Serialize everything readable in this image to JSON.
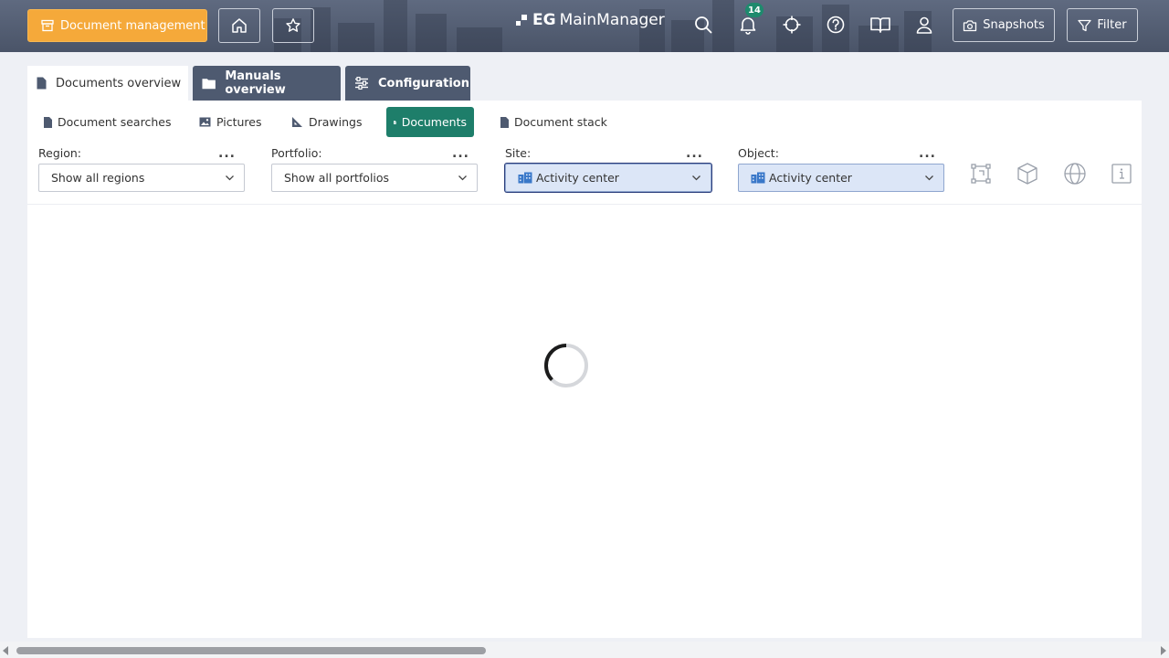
{
  "colors": {
    "accent_orange": "#f5a93a",
    "accent_green": "#1e7e6a",
    "header_bg": "#4e5a70",
    "badge_green": "#1e8a6d"
  },
  "header": {
    "module_button": "Document management",
    "logo_prefix": "EG",
    "logo_name": "MainManager",
    "notification_count": "14",
    "snapshots_label": "Snapshots",
    "filter_label": "Filter",
    "icons": [
      "archive-box-icon",
      "home-icon",
      "star-icon",
      "search-icon",
      "bell-icon",
      "crosshair-icon",
      "help-icon",
      "book-icon",
      "user-icon",
      "camera-icon",
      "filter-icon"
    ]
  },
  "tabs": [
    {
      "label": "Documents overview",
      "active": true
    },
    {
      "label": "Manuals overview",
      "active": false
    },
    {
      "label": "Configuration",
      "active": false
    }
  ],
  "subtabs": [
    {
      "label": "Document searches"
    },
    {
      "label": "Pictures"
    },
    {
      "label": "Drawings"
    },
    {
      "label": "Documents",
      "active": true
    },
    {
      "label": "Document stack"
    }
  ],
  "filters": {
    "region": {
      "label": "Region:",
      "value": "Show all regions"
    },
    "portfolio": {
      "label": "Portfolio:",
      "value": "Show all portfolios"
    },
    "site": {
      "label": "Site:",
      "value": "Activity center"
    },
    "object": {
      "label": "Object:",
      "value": "Activity center"
    },
    "more": "..."
  },
  "tool_icons": [
    "floorplan-icon",
    "cube-3d-icon",
    "globe-icon",
    "info-icon"
  ],
  "status": {
    "loading": true
  }
}
